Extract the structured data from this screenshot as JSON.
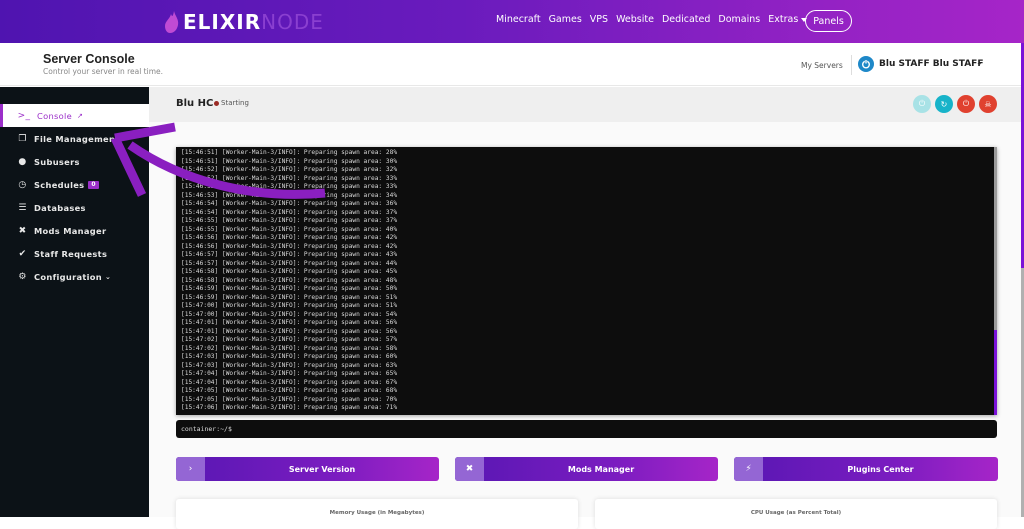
{
  "brand": {
    "part1": "ELIXIR",
    "part2": "NODE"
  },
  "topnav": {
    "links": [
      "Minecraft",
      "Games",
      "VPS",
      "Website",
      "Dedicated",
      "Domains",
      "Extras"
    ],
    "panels_label": "Panels"
  },
  "header": {
    "title": "Server Console",
    "subtitle": "Control your server in real time.",
    "my_servers": "My Servers",
    "user_name": "Blu STAFF Blu STAFF"
  },
  "sidebar": {
    "items": [
      {
        "label": "Console",
        "icon": "terminal-icon",
        "active": true
      },
      {
        "label": "File Management",
        "icon": "files-icon"
      },
      {
        "label": "Subusers",
        "icon": "users-icon"
      },
      {
        "label": "Schedules",
        "icon": "clock-icon",
        "badge": "0"
      },
      {
        "label": "Databases",
        "icon": "database-icon"
      },
      {
        "label": "Mods Manager",
        "icon": "mods-icon"
      },
      {
        "label": "Staff Requests",
        "icon": "check-icon"
      },
      {
        "label": "Configuration",
        "icon": "gears-icon"
      }
    ]
  },
  "server": {
    "name": "Blu HC",
    "status": "Starting",
    "status_color": "#9a2b25",
    "power_buttons": [
      {
        "name": "start",
        "color": "#a8e2e6"
      },
      {
        "name": "restart",
        "color": "#17b3c9"
      },
      {
        "name": "stop",
        "color": "#e0412f"
      },
      {
        "name": "kill",
        "color": "#e0412f"
      }
    ]
  },
  "console": {
    "lines": [
      [
        "15:46:51",
        "28%"
      ],
      [
        "15:46:51",
        "30%"
      ],
      [
        "15:46:52",
        "32%"
      ],
      [
        "15:46:52",
        "33%"
      ],
      [
        "15:46:53",
        "33%"
      ],
      [
        "15:46:53",
        "34%"
      ],
      [
        "15:46:54",
        "36%"
      ],
      [
        "15:46:54",
        "37%"
      ],
      [
        "15:46:55",
        "37%"
      ],
      [
        "15:46:55",
        "40%"
      ],
      [
        "15:46:56",
        "42%"
      ],
      [
        "15:46:56",
        "42%"
      ],
      [
        "15:46:57",
        "43%"
      ],
      [
        "15:46:57",
        "44%"
      ],
      [
        "15:46:58",
        "45%"
      ],
      [
        "15:46:58",
        "48%"
      ],
      [
        "15:46:59",
        "50%"
      ],
      [
        "15:46:59",
        "51%"
      ],
      [
        "15:47:00",
        "51%"
      ],
      [
        "15:47:00",
        "54%"
      ],
      [
        "15:47:01",
        "56%"
      ],
      [
        "15:47:01",
        "56%"
      ],
      [
        "15:47:02",
        "57%"
      ],
      [
        "15:47:02",
        "58%"
      ],
      [
        "15:47:03",
        "60%"
      ],
      [
        "15:47:03",
        "63%"
      ],
      [
        "15:47:04",
        "65%"
      ],
      [
        "15:47:04",
        "67%"
      ],
      [
        "15:47:05",
        "68%"
      ],
      [
        "15:47:05",
        "70%"
      ],
      [
        "15:47:06",
        "71%"
      ]
    ],
    "thread": "[Worker-Main-3/INFO]:",
    "message": "Preparing spawn area:",
    "prompt": "container:~/$"
  },
  "quick_buttons": [
    {
      "label": "Server Version",
      "icon": "chevron-right-icon"
    },
    {
      "label": "Mods Manager",
      "icon": "mods-icon"
    },
    {
      "label": "Plugins Center",
      "icon": "plug-icon"
    }
  ],
  "charts": {
    "memory_title": "Memory Usage (in Megabytes)",
    "cpu_title": "CPU Usage (as Percent Total)"
  },
  "colors": {
    "accent": "#9b2fc9",
    "nav_start": "#4f14b0",
    "nav_end": "#a625c8"
  }
}
